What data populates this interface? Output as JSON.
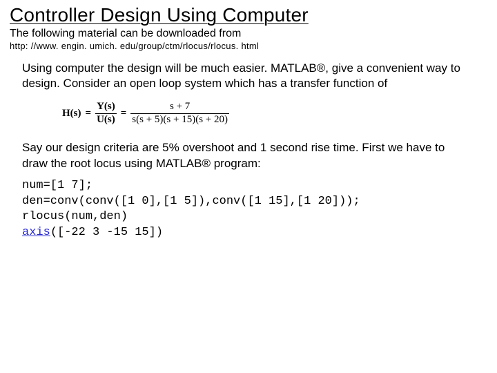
{
  "title": "Controller Design Using Computer",
  "subtitle": "The following material can be downloaded from",
  "url": "http: //www. engin. umich. edu/group/ctm/rlocus/rlocus. html",
  "para1": "Using computer the design will be much easier. MATLAB®, give a convenient way to design. Consider an open loop system which has a transfer function of",
  "equation": {
    "lhs": "H(s)",
    "mid_num": "Y(s)",
    "mid_den": "U(s)",
    "rhs_num": "s + 7",
    "rhs_den": "s(s + 5)(s + 15)(s + 20)"
  },
  "para2": "Say our design criteria are 5% overshoot and 1 second rise time. First we have to draw the root locus using MATLAB® program:",
  "code": {
    "l1": "num=[1 7];",
    "l2": "den=conv(conv([1 0],[1 5]),conv([1 15],[1 20]));",
    "l3": "rlocus(num,den)",
    "l4a": "axis",
    "l4b": "([-22 3 -15 15])"
  }
}
